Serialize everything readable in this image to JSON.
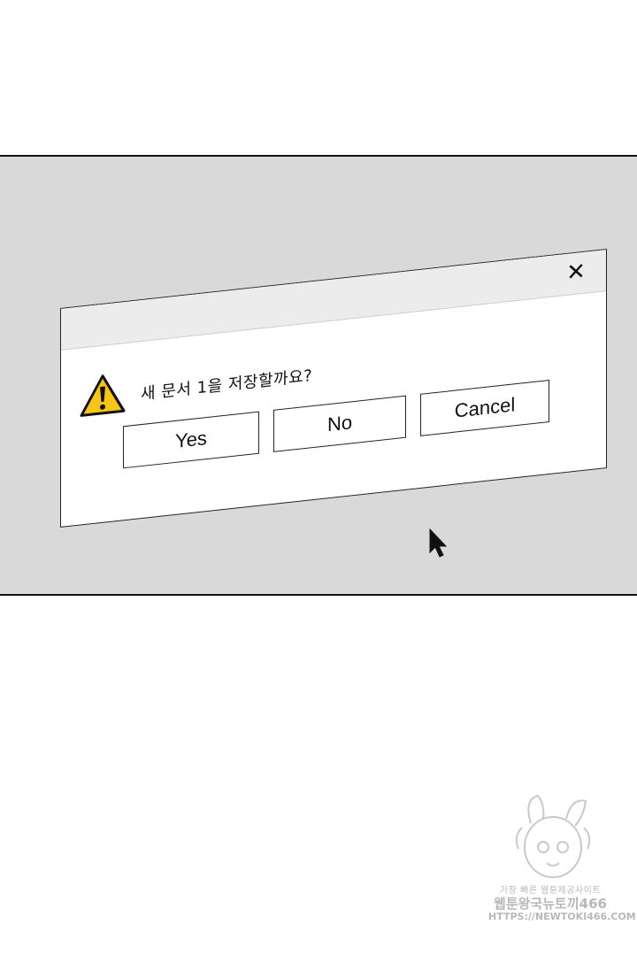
{
  "dialog": {
    "close_glyph": "✕",
    "icon": "warning-icon",
    "message": "새 문서 1을 저장할까요?",
    "buttons": {
      "yes": "Yes",
      "no": "No",
      "cancel": "Cancel"
    }
  },
  "cursor": {
    "icon": "mouse-pointer-icon"
  },
  "watermark": {
    "tagline": "가장 빠른 웹툰제공사이트",
    "name": "웹툰왕국뉴토끼466",
    "url": "HTTPS://NEWTOKI466.COM",
    "mascot_icon": "mascot-icon"
  },
  "colors": {
    "page_background": "#ffffff",
    "panel_background": "#d9d9d9",
    "dialog_background": "#ffffff",
    "titlebar_background": "#ececec",
    "warning_fill": "#f7c418",
    "outline": "#111111",
    "watermark": "#b8b8b8"
  }
}
